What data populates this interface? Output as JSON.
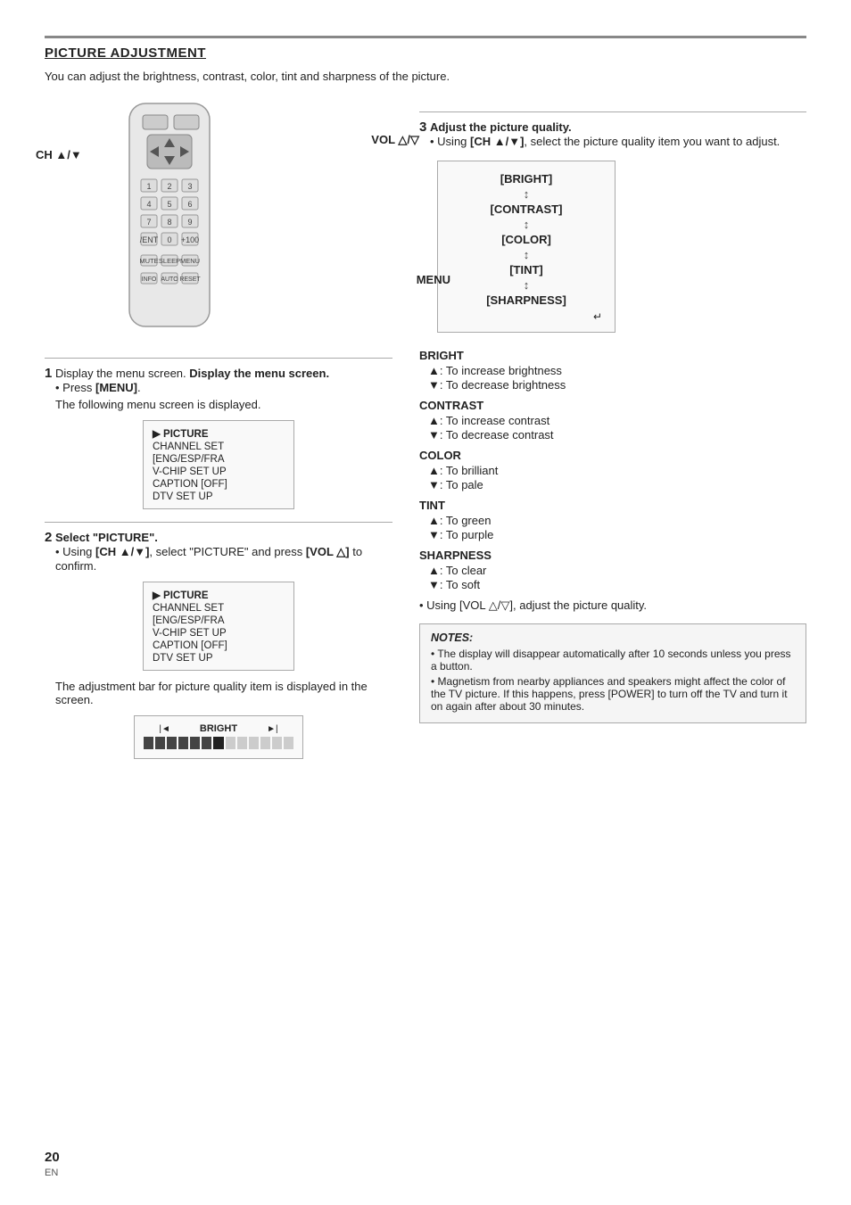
{
  "page": {
    "title": "PICTURE ADJUSTMENT",
    "intro": "You can adjust the brightness, contrast, color, tint and sharpness of the picture.",
    "labels": {
      "vol": "VOL △/▽",
      "ch": "CH ▲/▼",
      "menu": "MENU"
    },
    "step1": {
      "num": "1",
      "heading": "Display the menu screen.",
      "bullet1": "Press [MENU].",
      "bullet2": "The following menu screen is displayed."
    },
    "step2": {
      "num": "2",
      "heading": "Select \"PICTURE\".",
      "bullet1": "Using [CH ▲/▼], select \"PICTURE\" and press [VOL △] to confirm.",
      "bullet2": "The adjustment bar for picture quality item is displayed in the screen."
    },
    "step3": {
      "num": "3",
      "heading": "Adjust the picture quality.",
      "bullet1": "Using [CH ▲/▼], select the picture quality item you want to adjust."
    },
    "menu_items": [
      {
        "label": "▶ PICTURE",
        "selected": true
      },
      {
        "label": "CHANNEL SET",
        "selected": false
      },
      {
        "label": "[ENG/ESP/FRA",
        "selected": false
      },
      {
        "label": "V-CHIP SET UP",
        "selected": false
      },
      {
        "label": "CAPTION [OFF]",
        "selected": false
      },
      {
        "label": "DTV SET UP",
        "selected": false
      }
    ],
    "quality_items": [
      "[BRIGHT]",
      "[CONTRAST]",
      "[COLOR]",
      "[TINT]",
      "[SHARPNESS]"
    ],
    "adjustments": {
      "bright": {
        "title": "BRIGHT",
        "up": "▲: To increase brightness",
        "down": "▼: To decrease brightness"
      },
      "contrast": {
        "title": "CONTRAST",
        "up": "▲: To increase contrast",
        "down": "▼: To decrease contrast"
      },
      "color": {
        "title": "COLOR",
        "up": "▲: To brilliant",
        "down": "▼: To pale"
      },
      "tint": {
        "title": "TINT",
        "up": "▲: To green",
        "down": "▼: To purple"
      },
      "sharpness": {
        "title": "SHARPNESS",
        "up": "▲: To clear",
        "down": "▼: To soft"
      }
    },
    "vol_adjust": "• Using [VOL △/▽], adjust the picture quality.",
    "notes": {
      "title": "NOTES:",
      "item1": "• The display will disappear automatically after 10 seconds unless you press a button.",
      "item2": "• Magnetism from nearby appliances and speakers might affect the color of the TV picture. If this happens, press [POWER] to turn off the TV and turn it on again after about 30 minutes."
    },
    "footer": {
      "num": "20",
      "lang": "EN"
    }
  }
}
